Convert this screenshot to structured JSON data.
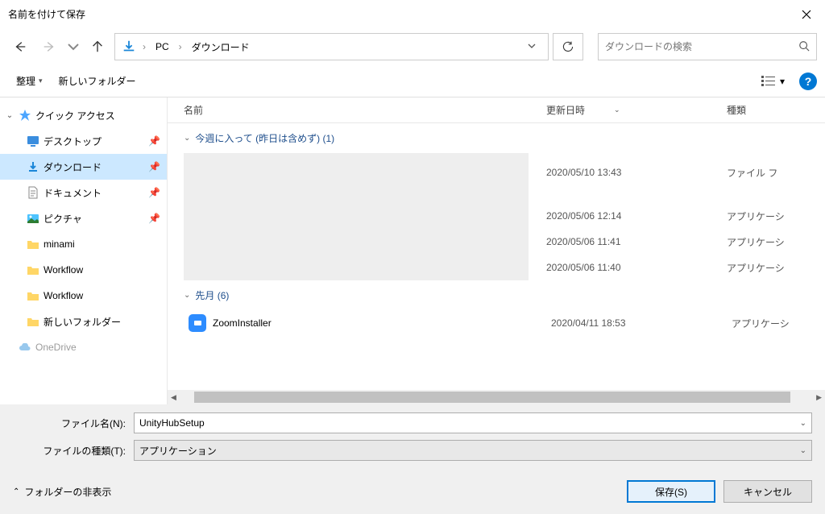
{
  "title": "名前を付けて保存",
  "breadcrumb": {
    "pc": "PC",
    "downloads": "ダウンロード"
  },
  "search": {
    "placeholder": "ダウンロードの検索"
  },
  "toolbar": {
    "organize": "整理",
    "newfolder": "新しいフォルダー"
  },
  "columns": {
    "name": "名前",
    "modified": "更新日時",
    "type": "種類"
  },
  "sidebar": {
    "quickaccess": "クイック アクセス",
    "desktop": "デスクトップ",
    "downloads": "ダウンロード",
    "documents": "ドキュメント",
    "pictures": "ピクチャ",
    "minami": "minami",
    "workflow1": "Workflow",
    "workflow2": "Workflow",
    "newfolder": "新しいフォルダー",
    "onedrive": "OneDrive"
  },
  "groups": {
    "thisweek": "今週に入って (昨日は含めず) (1)",
    "lastmonth": "先月 (6)"
  },
  "rows": [
    {
      "date": "2020/05/10 13:43",
      "type": "ファイル フ"
    },
    {
      "date": "2020/05/06 12:14",
      "type": "アプリケーシ"
    },
    {
      "date": "2020/05/06 11:41",
      "type": "アプリケーシ"
    },
    {
      "date": "2020/05/06 11:40",
      "type": "アプリケーシ"
    }
  ],
  "zoom": {
    "name": "ZoomInstaller",
    "date": "2020/04/11 18:53",
    "type": "アプリケーシ"
  },
  "form": {
    "filename_label": "ファイル名(N):",
    "filename_value": "UnityHubSetup",
    "filetype_label": "ファイルの種類(T):",
    "filetype_value": "アプリケーション"
  },
  "buttons": {
    "hide": "フォルダーの非表示",
    "save": "保存(S)",
    "cancel": "キャンセル"
  }
}
